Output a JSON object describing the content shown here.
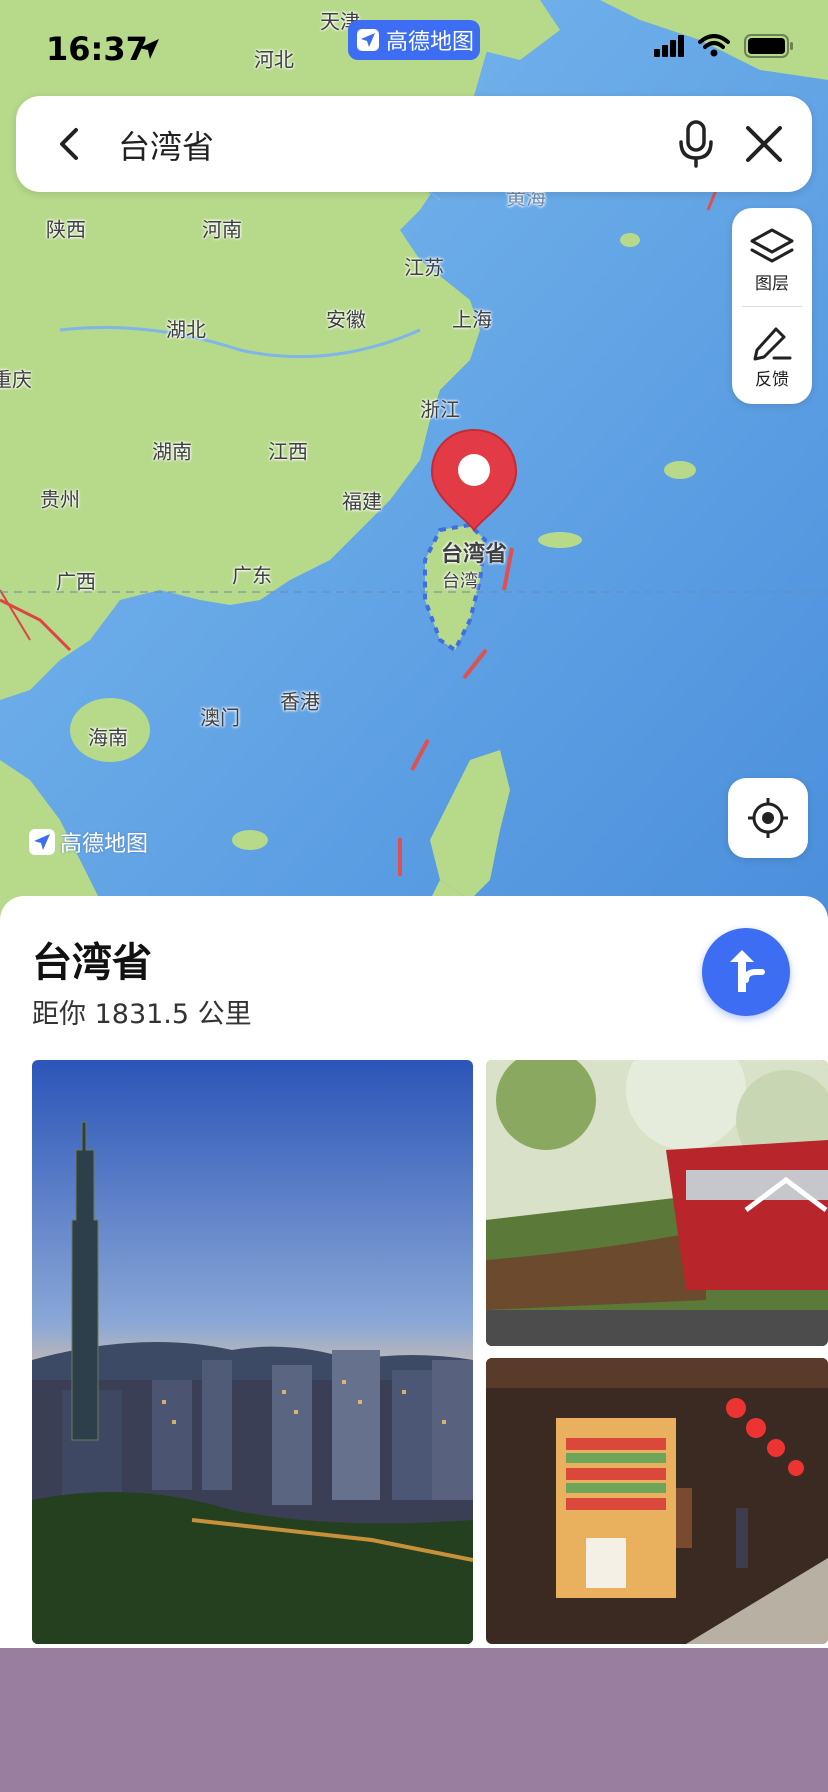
{
  "status_bar": {
    "time": "16:37",
    "app_badge": "高德地图"
  },
  "search": {
    "query": "台湾省"
  },
  "side_panel": {
    "layers_label": "图层",
    "feedback_label": "反馈"
  },
  "map": {
    "logo_text": "高德地图",
    "marker_label": "台湾省",
    "labels": {
      "tianjin": "天津",
      "hebei": "河北",
      "shaanxi": "陕西",
      "henan": "河南",
      "jiangsu": "江苏",
      "anhui": "安徽",
      "shanghai": "上海",
      "hubei": "湖北",
      "chongqing": "重庆",
      "zhejiang": "浙江",
      "hunan": "湖南",
      "jiangxi": "江西",
      "guizhou": "贵州",
      "fujian": "福建",
      "guangxi": "广西",
      "guangdong": "广东",
      "taiwan": "台湾",
      "macau": "澳门",
      "hongkong": "香港",
      "hainan": "海南",
      "yellow_sea": "黄海"
    }
  },
  "place": {
    "title": "台湾省",
    "distance": "距你 1831.5 公里"
  },
  "colors": {
    "accent": "#3d6df2",
    "marker": "#e23b45",
    "land": "#b7d985",
    "sea": "#5da2e4"
  }
}
